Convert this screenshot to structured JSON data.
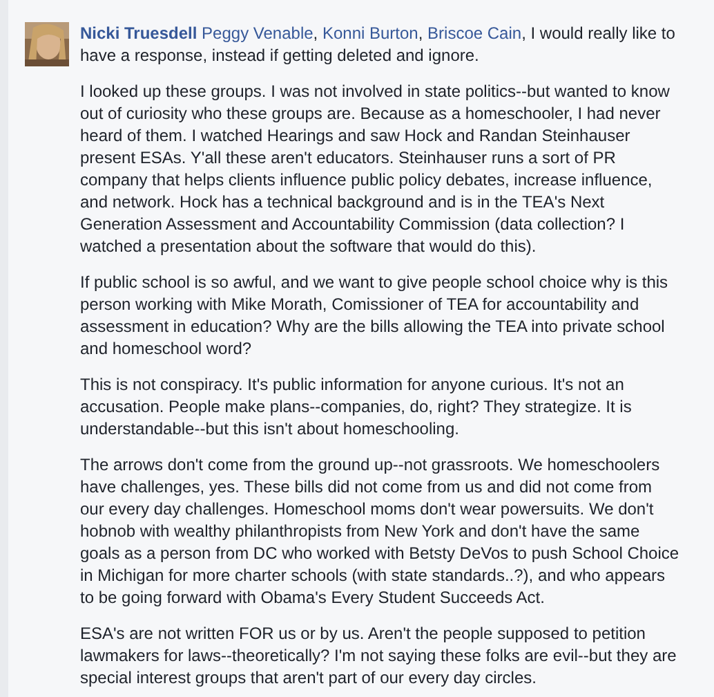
{
  "comment": {
    "first_paragraph": [
      {
        "kind": "author",
        "text": "Nicki Truesdell"
      },
      {
        "kind": "mention",
        "text": "Peggy Venable"
      },
      {
        "kind": "plain",
        "text": ", "
      },
      {
        "kind": "mention",
        "text": "Konni Burton"
      },
      {
        "kind": "plain",
        "text": ", "
      },
      {
        "kind": "mention",
        "text": "Briscoe Cain"
      },
      {
        "kind": "plain",
        "text": ", I would really like to have a response, instead if getting deleted and ignore."
      }
    ],
    "paragraphs": [
      "I looked up these groups. I was not involved in state politics--but wanted to know out of curiosity who these groups are. Because as a homeschooler, I had never heard of them. I watched Hearings and saw Hock and Randan Steinhauser present ESAs. Y'all these aren't educators. Steinhauser runs a sort of PR company that helps clients influence public policy debates, increase influence, and network. Hock has a technical background and is in the TEA's Next Generation Assessment and Accountability Commission (data collection? I watched a presentation about the software that would do this).",
      "If public school is so awful, and we want to give people school choice why is this person working with Mike Morath, Comissioner of TEA for accountability and assessment in education? Why are the bills allowing the TEA into private school and homeschool word?",
      "This is not conspiracy. It's public information for anyone curious. It's not an accusation. People make plans--companies, do, right? They strategize. It is understandable--but this isn't about homeschooling.",
      "The arrows don't come from the ground up--not grassroots. We homeschoolers have challenges, yes. These bills did not come from us and did not come from our every day challenges. Homeschool moms don't wear powersuits. We don't hobnob with wealthy philanthropists from New York and don't have the same goals as a person from DC who worked with Betsty DeVos to push School Choice in Michigan for more charter schools (with state standards..?), and who appears to be going forward with Obama's Every Student Succeeds Act.",
      "ESA's are not written FOR us or by us. Aren't the people supposed to petition lawmakers for laws--theoretically? I'm not saying these folks are evil--but they are special interest groups that aren't part of our every day circles."
    ]
  }
}
